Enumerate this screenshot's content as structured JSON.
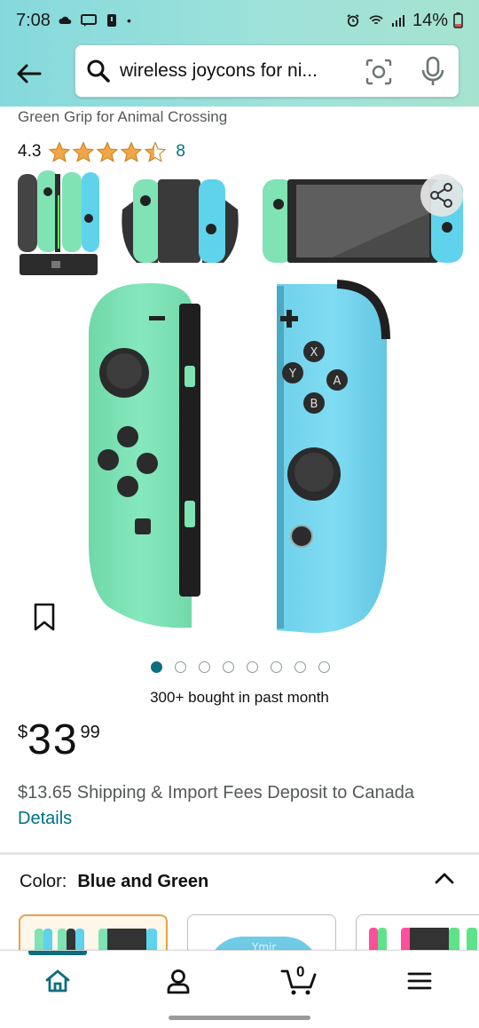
{
  "status_bar": {
    "time": "7:08",
    "battery": "14%"
  },
  "search": {
    "query": "wireless joycons for ni..."
  },
  "product": {
    "subtitle": "Green Grip for Animal Crossing",
    "rating": "4.3",
    "rating_count": "8",
    "stars_value": 4.3,
    "image_pages": 8,
    "active_image_page": 1,
    "bought_text": "300+ bought in past month",
    "price": {
      "symbol": "$",
      "whole": "33",
      "fraction": "99"
    },
    "shipping_text": "$13.65 Shipping & Import Fees Deposit to Canada",
    "details_link": "Details"
  },
  "variant": {
    "label": "Color:",
    "value": "Blue and Green",
    "swatch_watermark": "Ymir"
  },
  "bottom_nav": {
    "cart_count": "0",
    "items": [
      "home-icon",
      "account-icon",
      "cart-icon",
      "menu-icon"
    ]
  },
  "colors": {
    "teal_accent": "#007185",
    "nav_active": "#0d6e7e",
    "star": "#f3a847",
    "joycon_green": "#7fe3b3",
    "joycon_blue": "#5fd3ec"
  }
}
